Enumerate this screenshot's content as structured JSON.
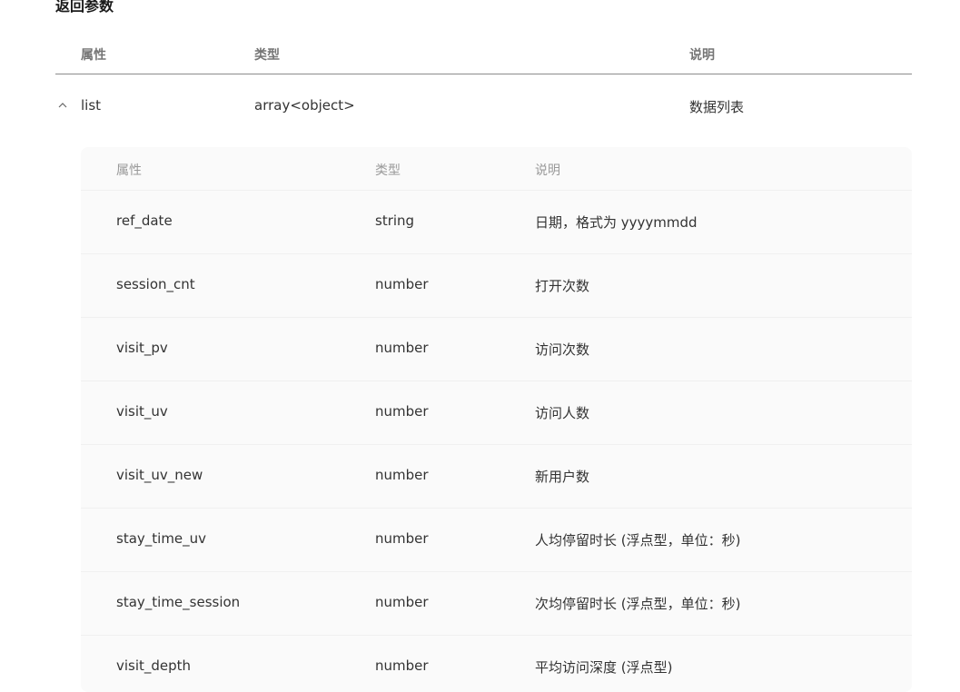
{
  "section": {
    "title": "返回参数"
  },
  "outer_table": {
    "headers": [
      "属性",
      "类型",
      "说明"
    ],
    "row": {
      "name": "list",
      "type": "array<object>",
      "description": "数据列表",
      "toggle_icon": "chevron-up-icon"
    }
  },
  "nested_table": {
    "headers": [
      "属性",
      "类型",
      "说明"
    ],
    "rows": [
      {
        "name": "ref_date",
        "type": "string",
        "description": "日期，格式为 yyyymmdd"
      },
      {
        "name": "session_cnt",
        "type": "number",
        "description": "打开次数"
      },
      {
        "name": "visit_pv",
        "type": "number",
        "description": "访问次数"
      },
      {
        "name": "visit_uv",
        "type": "number",
        "description": "访问人数"
      },
      {
        "name": "visit_uv_new",
        "type": "number",
        "description": "新用户数"
      },
      {
        "name": "stay_time_uv",
        "type": "number",
        "description": "人均停留时长 (浮点型，单位：秒)"
      },
      {
        "name": "stay_time_session",
        "type": "number",
        "description": "次均停留时长 (浮点型，单位：秒)"
      },
      {
        "name": "visit_depth",
        "type": "number",
        "description": "平均访问深度 (浮点型)"
      }
    ]
  }
}
